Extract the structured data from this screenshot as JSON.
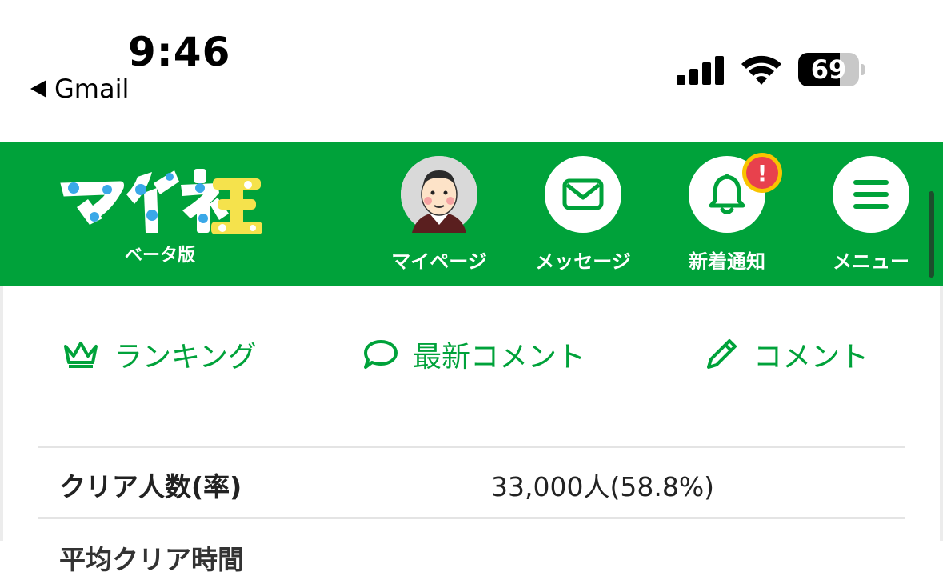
{
  "status_bar": {
    "time": "9:46",
    "back_app": "Gmail",
    "battery_percent": "69",
    "battery_level": 0.69
  },
  "header": {
    "logo_text": "マイネ王",
    "logo_sub": "ベータ版",
    "brand_color": "#00a23a",
    "nav": [
      {
        "label": "マイページ",
        "icon": "avatar"
      },
      {
        "label": "メッセージ",
        "icon": "mail-icon"
      },
      {
        "label": "新着通知",
        "icon": "bell-icon",
        "badge": "!"
      },
      {
        "label": "メニュー",
        "icon": "hamburger-icon"
      }
    ]
  },
  "tabs": [
    {
      "label": "ランキング",
      "icon": "crown-icon"
    },
    {
      "label": "最新コメント",
      "icon": "speech-bubble-icon"
    },
    {
      "label": "コメント",
      "icon": "pencil-icon"
    }
  ],
  "stats": [
    {
      "label": "クリア人数(率)",
      "value": "33,000人(58.8%)"
    },
    {
      "label": "平均クリア時間",
      "value": ""
    }
  ]
}
